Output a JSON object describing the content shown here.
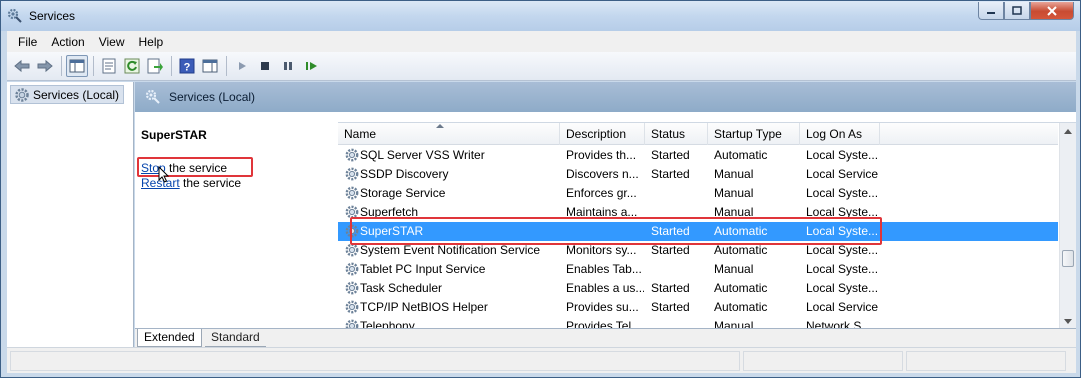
{
  "window": {
    "title": "Services"
  },
  "menu": [
    "File",
    "Action",
    "View",
    "Help"
  ],
  "toolbar": {
    "icons": [
      "back-arrow-icon",
      "forward-arrow-icon",
      "show-hide-console-tree-icon",
      "properties-icon",
      "refresh-icon",
      "export-list-icon",
      "help-icon",
      "show-action-pane-icon",
      "start-service-icon",
      "stop-service-icon",
      "pause-service-icon",
      "restart-service-icon"
    ]
  },
  "tree": {
    "root_label": "Services (Local)"
  },
  "panel": {
    "header": "Services (Local)"
  },
  "detail": {
    "service_name": "SuperSTAR",
    "stop_link": "Stop",
    "stop_suffix": " the service",
    "restart_link": "Restart",
    "restart_suffix": " the service"
  },
  "columns": [
    "Name",
    "Description",
    "Status",
    "Startup Type",
    "Log On As"
  ],
  "rows": [
    {
      "name": "SQL Server VSS Writer",
      "description": "Provides th...",
      "status": "Started",
      "startup": "Automatic",
      "logon": "Local Syste..."
    },
    {
      "name": "SSDP Discovery",
      "description": "Discovers n...",
      "status": "Started",
      "startup": "Manual",
      "logon": "Local Service"
    },
    {
      "name": "Storage Service",
      "description": "Enforces gr...",
      "status": "",
      "startup": "Manual",
      "logon": "Local Syste..."
    },
    {
      "name": "Superfetch",
      "description": "Maintains a...",
      "status": "",
      "startup": "Manual",
      "logon": "Local Syste..."
    },
    {
      "name": "SuperSTAR",
      "description": "",
      "status": "Started",
      "startup": "Automatic",
      "logon": "Local Syste...",
      "selected": true
    },
    {
      "name": "System Event Notification Service",
      "description": "Monitors sy...",
      "status": "Started",
      "startup": "Automatic",
      "logon": "Local Syste..."
    },
    {
      "name": "Tablet PC Input Service",
      "description": "Enables Tab...",
      "status": "",
      "startup": "Manual",
      "logon": "Local Syste..."
    },
    {
      "name": "Task Scheduler",
      "description": "Enables a us...",
      "status": "Started",
      "startup": "Automatic",
      "logon": "Local Syste..."
    },
    {
      "name": "TCP/IP NetBIOS Helper",
      "description": "Provides su...",
      "status": "Started",
      "startup": "Automatic",
      "logon": "Local Service"
    },
    {
      "name": "Telephony",
      "description": "Provides Tel...",
      "status": "",
      "startup": "Manual",
      "logon": "Network S..."
    }
  ],
  "tabs": [
    "Extended",
    "Standard"
  ],
  "colors": {
    "selection": "#3399ff",
    "highlight_box": "#e0353a"
  }
}
